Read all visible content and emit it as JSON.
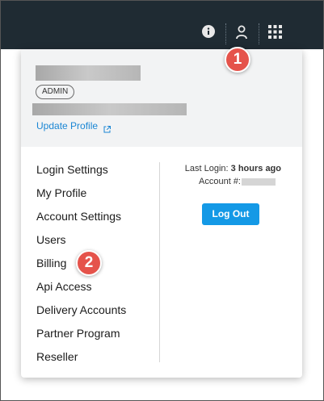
{
  "topbar": {
    "icons": [
      "info-icon",
      "user-icon",
      "apps-grid-icon"
    ],
    "background": "#1f2b33"
  },
  "profile": {
    "badge": "ADMIN",
    "update_link": "Update Profile"
  },
  "menu": {
    "items": [
      "Login Settings",
      "My Profile",
      "Account Settings",
      "Users",
      "Billing",
      "Api Access",
      "Delivery Accounts",
      "Partner Program",
      "Reseller"
    ]
  },
  "session": {
    "last_login_label": "Last Login:",
    "last_login_value": "3 hours ago",
    "account_label": "Account #:",
    "logout_label": "Log Out"
  },
  "callouts": {
    "one": "1",
    "two": "2"
  },
  "colors": {
    "accent": "#1499e6",
    "link": "#1a86d4",
    "callout": "#e5534b"
  }
}
